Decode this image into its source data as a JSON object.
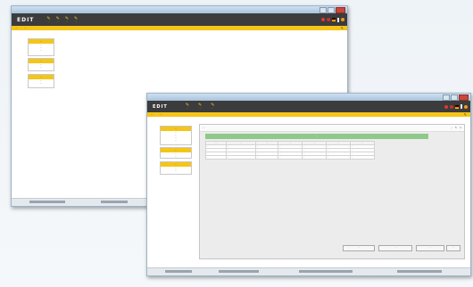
{
  "colors": {
    "accent": "#f5c518",
    "appbar": "#3c3c3c",
    "green": "#8fc98a"
  },
  "win1": {
    "title": "...",
    "logo": "EDIT",
    "nav": [
      {
        "icon": "pencil-icon",
        "label": "..."
      },
      {
        "icon": "pencil-icon",
        "label": "..."
      },
      {
        "icon": "pencil-icon",
        "label": "..."
      },
      {
        "icon": "pencil-icon",
        "label": "..."
      }
    ],
    "tabs": [
      "...",
      "..."
    ],
    "boxes": [
      {
        "header": "...",
        "rows": [
          "...",
          "...",
          "..."
        ]
      },
      {
        "header": "...",
        "rows": [
          "...",
          "..."
        ]
      },
      {
        "header": "...",
        "rows": [
          "...",
          "..."
        ]
      }
    ]
  },
  "win2": {
    "title": "...",
    "logo": "EDIT",
    "nav": [
      {
        "icon": "pencil-icon",
        "label": "..."
      },
      {
        "icon": "pencil-icon",
        "label": "..."
      },
      {
        "icon": "pencil-icon",
        "label": "..."
      }
    ],
    "tabs": [
      "...",
      "..."
    ],
    "boxes": [
      {
        "header": "...",
        "rows": [
          "...",
          "...",
          "...",
          "..."
        ]
      },
      {
        "header": "...",
        "rows": [
          "...",
          "..."
        ]
      },
      {
        "header": "...",
        "rows": [
          "...",
          "..."
        ]
      }
    ],
    "panel": {
      "title": "...",
      "green_header": "...",
      "columns": [
        "...",
        "...",
        "...",
        "...",
        "...",
        "...",
        "..."
      ],
      "rows": [
        [
          "...",
          "...",
          "...",
          "...",
          "...",
          "...",
          "..."
        ],
        [
          "...",
          "...",
          "...",
          "...",
          "...",
          "...",
          "..."
        ],
        [
          "...",
          "...",
          "...",
          "...",
          "...",
          "...",
          "..."
        ],
        [
          "...",
          "...",
          "...",
          "...",
          "...",
          "...",
          "..."
        ]
      ],
      "buttons": [
        "...",
        "...",
        "...",
        "..."
      ]
    }
  }
}
